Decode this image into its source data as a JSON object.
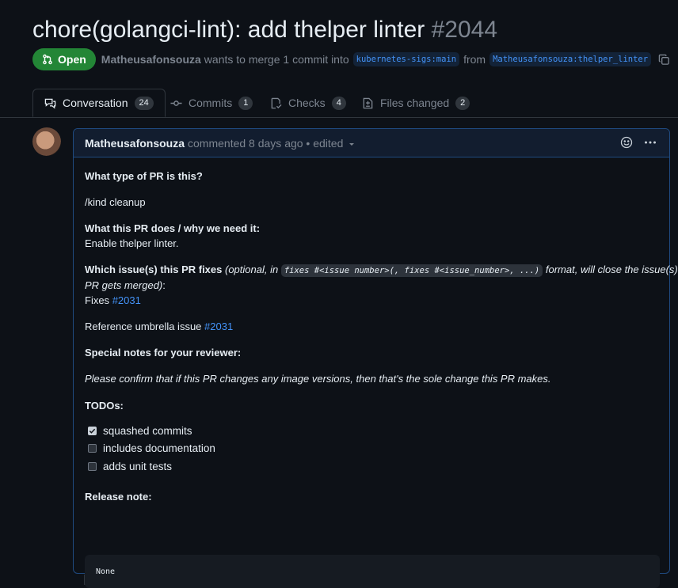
{
  "pr": {
    "title": "chore(golangci-lint): add thelper linter",
    "number": "#2044",
    "state": "Open",
    "author": "Matheusafonsouza",
    "merge_text": "wants to merge 1 commit into",
    "base_branch": "kubernetes-sigs:main",
    "from_text": "from",
    "head_branch": "Matheusafonsouza:thelper_linter"
  },
  "tabs": [
    {
      "label": "Conversation",
      "count": "24"
    },
    {
      "label": "Commits",
      "count": "1"
    },
    {
      "label": "Checks",
      "count": "4"
    },
    {
      "label": "Files changed",
      "count": "2"
    }
  ],
  "comment": {
    "author": "Matheusafonsouza",
    "meta": "commented 8 days ago • edited",
    "q1": "What type of PR is this?",
    "kind": "/kind cleanup",
    "q2": "What this PR does / why we need it:",
    "a2": "Enable thelper linter.",
    "q3": "Which issue(s) this PR fixes",
    "q3_opt_a": "(optional, in",
    "q3_code": "fixes #<issue number>(, fixes #<issue_number>, ...)",
    "q3_opt_b": "format, will close the issue(s) when",
    "q3_opt_c": "PR gets merged)",
    "q3_colon": ":",
    "fixes_label": "Fixes",
    "fixes_link": "#2031",
    "ref_label": "Reference umbrella issue",
    "ref_link": "#2031",
    "q4": "Special notes for your reviewer:",
    "notes": "Please confirm that if this PR changes any image versions, then that's the sole change this PR makes.",
    "todos": "TODOs:",
    "tasks": [
      {
        "label": "squashed commits",
        "checked": true
      },
      {
        "label": "includes documentation",
        "checked": false
      },
      {
        "label": "adds unit tests",
        "checked": false
      }
    ],
    "release_title": "Release note:",
    "release_note": "None"
  }
}
